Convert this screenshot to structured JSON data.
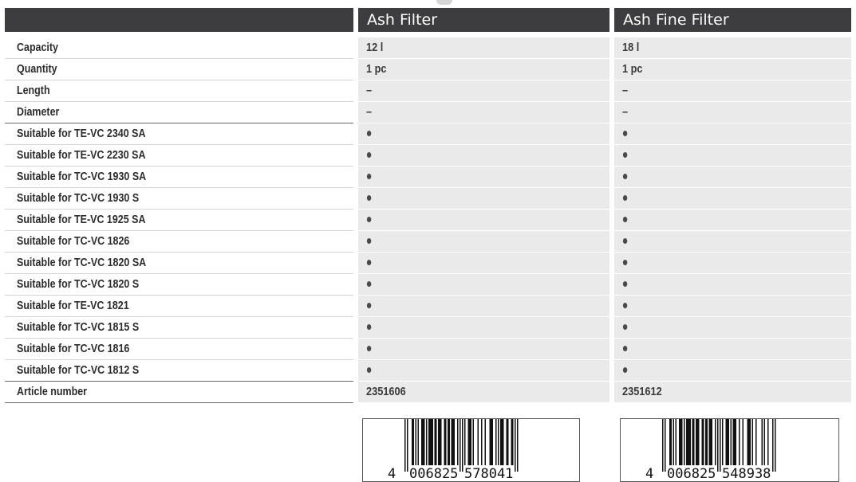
{
  "columns": [
    "Ash Filter",
    "Ash Fine Filter"
  ],
  "rows": [
    {
      "label": "Capacity",
      "v1": "12 l",
      "v2": "18 l"
    },
    {
      "label": "Quantity",
      "v1": "1 pc",
      "v2": "1 pc"
    },
    {
      "label": "Length",
      "v1": "–",
      "v2": "–"
    },
    {
      "label": "Diameter",
      "v1": "–",
      "v2": "–"
    },
    {
      "label": "Suitable for TE-VC 2340 SA",
      "v1": "•",
      "v2": "•"
    },
    {
      "label": "Suitable for TE-VC 2230 SA",
      "v1": "•",
      "v2": "•"
    },
    {
      "label": "Suitable for TC-VC 1930 SA",
      "v1": "•",
      "v2": "•"
    },
    {
      "label": "Suitable for TC-VC 1930 S",
      "v1": "•",
      "v2": "•"
    },
    {
      "label": "Suitable for TE-VC 1925 SA",
      "v1": "•",
      "v2": "•"
    },
    {
      "label": "Suitable for TC-VC 1826",
      "v1": "•",
      "v2": "•"
    },
    {
      "label": "Suitable for TC-VC 1820 SA",
      "v1": "•",
      "v2": "•"
    },
    {
      "label": "Suitable for TC-VC 1820 S",
      "v1": "•",
      "v2": "•"
    },
    {
      "label": "Suitable for TE-VC 1821",
      "v1": "•",
      "v2": "•"
    },
    {
      "label": "Suitable for TC-VC 1815 S",
      "v1": "•",
      "v2": "•"
    },
    {
      "label": "Suitable for TC-VC 1816",
      "v1": "•",
      "v2": "•"
    },
    {
      "label": "Suitable for TC-VC 1812 S",
      "v1": "•",
      "v2": "•"
    },
    {
      "label": "Article number",
      "v1": "2351606",
      "v2": "2351612"
    }
  ],
  "barcodes": [
    {
      "first": "4",
      "left": "006825",
      "right": "578041"
    },
    {
      "first": "4",
      "left": "006825",
      "right": "548938"
    }
  ],
  "colors": {
    "header_bg": "#3d3d3f",
    "cell_bg": "#eaeaea",
    "text": "#2c2c2c"
  }
}
